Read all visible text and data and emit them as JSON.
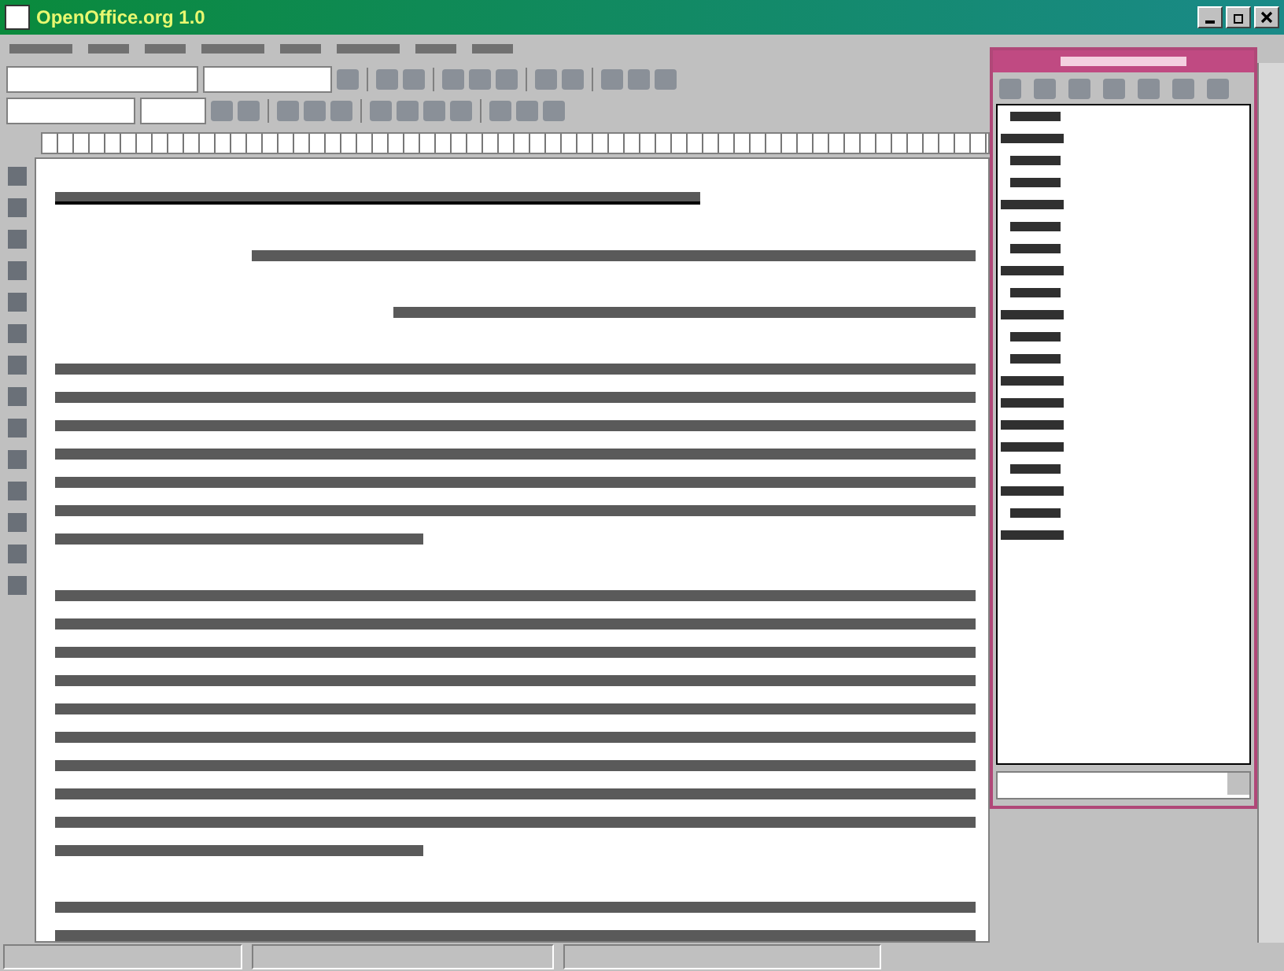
{
  "window": {
    "title": "OpenOffice.org 1.0"
  },
  "menu_items": [
    {
      "kind": "long"
    },
    {
      "kind": "short"
    },
    {
      "kind": "short"
    },
    {
      "kind": "long"
    },
    {
      "kind": "short"
    },
    {
      "kind": "long"
    },
    {
      "kind": "short"
    },
    {
      "kind": "short"
    }
  ],
  "document": {
    "lines": [
      {
        "kind": "heading"
      },
      {
        "kind": "gap"
      },
      {
        "kind": "center"
      },
      {
        "kind": "gap"
      },
      {
        "kind": "center-short"
      },
      {
        "kind": "gap"
      },
      {
        "kind": "full"
      },
      {
        "kind": "full"
      },
      {
        "kind": "full"
      },
      {
        "kind": "full"
      },
      {
        "kind": "full"
      },
      {
        "kind": "full"
      },
      {
        "kind": "last"
      },
      {
        "kind": "gap"
      },
      {
        "kind": "full"
      },
      {
        "kind": "full"
      },
      {
        "kind": "full"
      },
      {
        "kind": "full"
      },
      {
        "kind": "full"
      },
      {
        "kind": "full"
      },
      {
        "kind": "full"
      },
      {
        "kind": "full"
      },
      {
        "kind": "full"
      },
      {
        "kind": "last"
      },
      {
        "kind": "gap"
      },
      {
        "kind": "full"
      },
      {
        "kind": "full"
      }
    ]
  },
  "stylist": {
    "items": [
      {
        "kind": "indent"
      },
      {
        "kind": "flush"
      },
      {
        "kind": "indent"
      },
      {
        "kind": "indent"
      },
      {
        "kind": "flush"
      },
      {
        "kind": "indent"
      },
      {
        "kind": "indent"
      },
      {
        "kind": "flush"
      },
      {
        "kind": "indent"
      },
      {
        "kind": "flush"
      },
      {
        "kind": "indent"
      },
      {
        "kind": "indent"
      },
      {
        "kind": "flush"
      },
      {
        "kind": "flush"
      },
      {
        "kind": "flush"
      },
      {
        "kind": "flush"
      },
      {
        "kind": "indent"
      },
      {
        "kind": "flush"
      },
      {
        "kind": "indent"
      },
      {
        "kind": "flush"
      }
    ]
  }
}
